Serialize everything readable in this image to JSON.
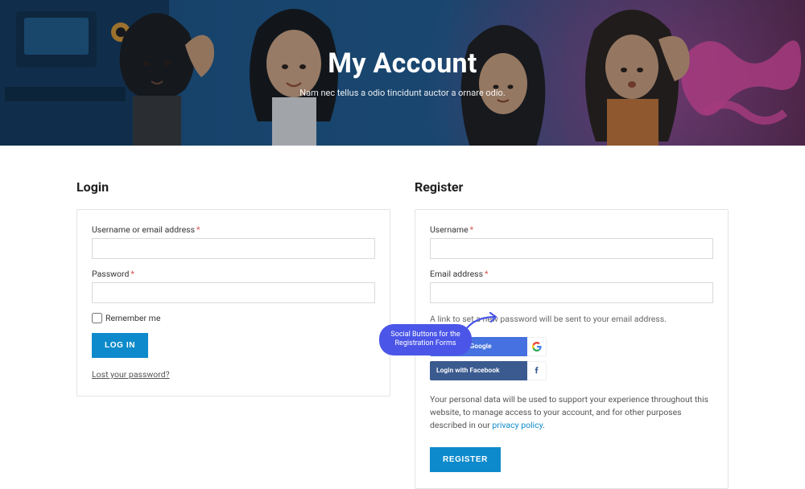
{
  "hero": {
    "title": "My Account",
    "subtitle": "Nam nec tellus a odio tincidunt auctor a ornare odio."
  },
  "login": {
    "heading": "Login",
    "username_label": "Username or email address",
    "password_label": "Password",
    "remember_label": "Remember me",
    "button_label": "LOG IN",
    "lost_link": "Lost your password?"
  },
  "register": {
    "heading": "Register",
    "username_label": "Username",
    "email_label": "Email address",
    "helper_text": "A link to set a new password will be sent to your email address.",
    "social_google_label": "Login with Google",
    "social_facebook_label": "Login with Facebook",
    "privacy_text": "Your personal data will be used to support your experience throughout this website, to manage access to your account, and for other purposes described in our ",
    "privacy_link_label": "privacy policy",
    "privacy_suffix": ".",
    "button_label": "REGISTER"
  },
  "callout": {
    "text": "Social Buttons for the Registration Forms"
  },
  "colors": {
    "primary": "#0d8acb",
    "callout": "#4b56e8",
    "google": "#4671e0",
    "facebook": "#3b5a8f"
  }
}
